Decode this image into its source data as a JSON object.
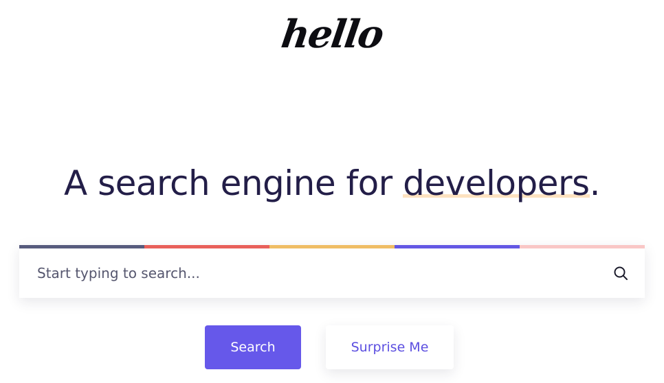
{
  "logo": {
    "text": "hello"
  },
  "headline": {
    "prefix": "A search engine for ",
    "highlight": "developers",
    "suffix": "."
  },
  "search": {
    "placeholder": "Start typing to search...",
    "value": "",
    "stripe_colors": [
      "#575b7d",
      "#e8605a",
      "#efbd65",
      "#6357e3",
      "#f9c7c6"
    ]
  },
  "buttons": {
    "search_label": "Search",
    "surprise_label": "Surprise Me"
  },
  "colors": {
    "accent": "#6658ea",
    "headline": "#231e48",
    "highlight": "#fde2c0"
  }
}
